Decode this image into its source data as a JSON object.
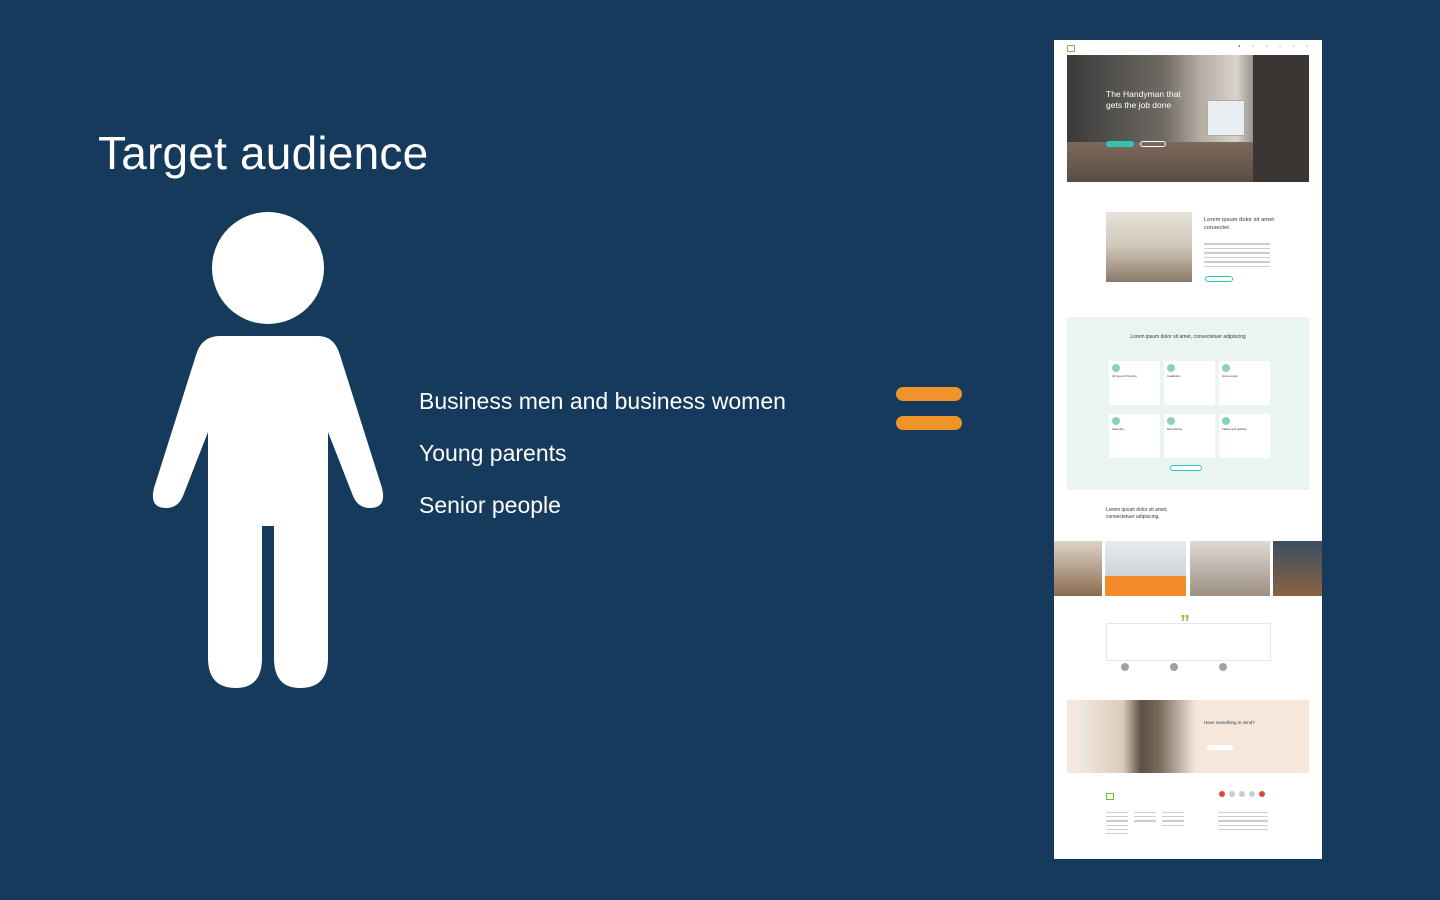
{
  "slide": {
    "title": "Target audience",
    "audience": [
      "Business men and business women",
      "Young parents",
      "Senior people"
    ]
  },
  "colors": {
    "background": "#153a5b",
    "accent": "#f0932b",
    "text": "#ffffff"
  },
  "icons": {
    "person": "person-icon",
    "equals": "equals-icon"
  },
  "preview": {
    "hero_heading": "The Handyman that gets the job done",
    "about_title": "Lorem ipsum dolor sit amet consectet",
    "services_title": "Lorem ipsum dolor sit amet, consectetuer adipiscing",
    "service_cards": [
      "All types of Flooring",
      "Installation",
      "Home repair",
      "Assembly",
      "Remodeling",
      "Plaster and painting"
    ],
    "projects_title": "Lorem ipsum dolor sit amet, consectetuer adipiscing.",
    "cta_title": "Have something in mind?"
  }
}
